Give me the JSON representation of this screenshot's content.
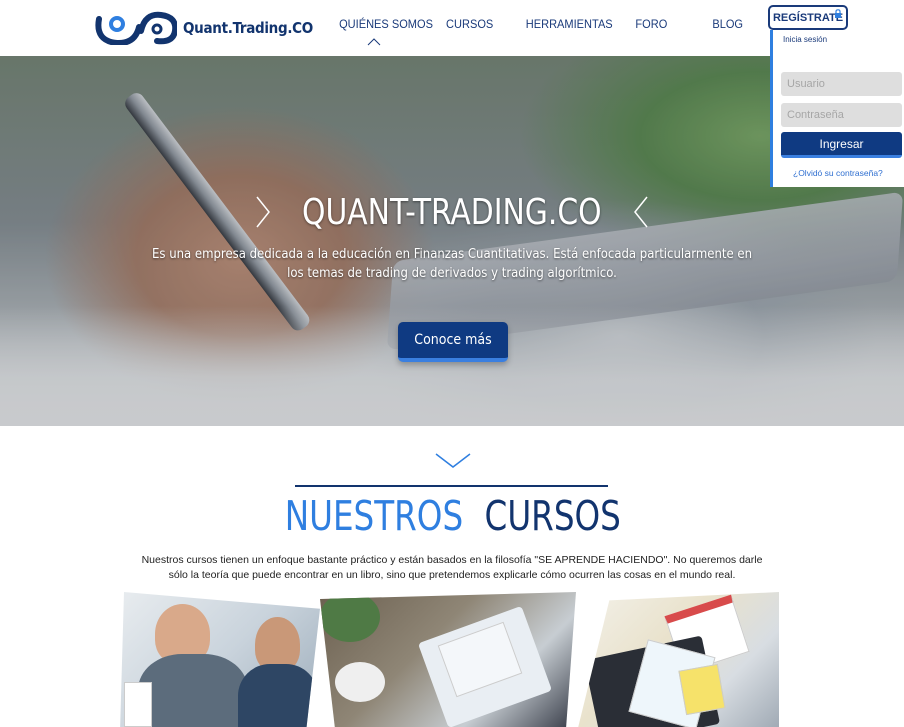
{
  "brand": {
    "name": "Quant.Trading.CO",
    "colors": {
      "primary": "#12346e",
      "accent": "#2f7fe0",
      "button": "#0f3a82"
    }
  },
  "nav": {
    "items": [
      {
        "label": "QUIÉNES SOMOS",
        "active": true
      },
      {
        "label": "CURSOS"
      },
      {
        "label": "HERRAMIENTAS"
      },
      {
        "label": "FORO"
      },
      {
        "label": "BLOG"
      }
    ],
    "register_label": "REGÍSTRATE",
    "register_icon": "lock-icon"
  },
  "login": {
    "title": "Inicia sesión",
    "username_placeholder": "Usuario",
    "password_placeholder": "Contraseña",
    "submit_label": "Ingresar",
    "forgot_label": "¿Olvidó su contraseña?"
  },
  "hero": {
    "title": "QUANT-TRADING.CO",
    "description": "Es una empresa dedicada a la educación en Finanzas Cuantitativas. Está enfocada particularmente en los temas de trading de derivados y trading algorítmico.",
    "cta_label": "Conoce más"
  },
  "courses": {
    "title_part1": "NUESTROS",
    "title_part2": "CURSOS",
    "description": "Nuestros cursos tienen un enfoque bastante práctico y están basados en la filosofía \"SE APRENDE HACIENDO\". No queremos darle sólo la teoría que puede encontrar en un libro, sino que pretendemos explicarle cómo ocurren las cosas en el mundo real."
  }
}
